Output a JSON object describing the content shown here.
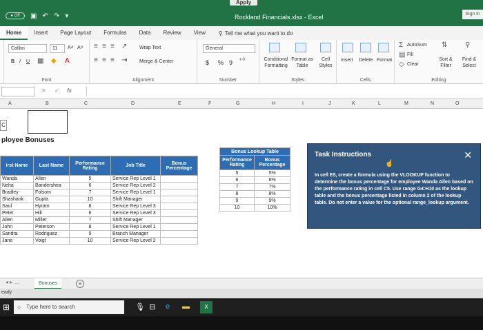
{
  "window": {
    "apply_label": "Apply",
    "title": "Rockland Financials.xlsx - Excel",
    "autosave_label": "● Off",
    "sign_in": "Sign in"
  },
  "tabs": [
    "Home",
    "Insert",
    "Page Layout",
    "Formulas",
    "Data",
    "Review",
    "View"
  ],
  "tell_me": "Tell me what you want to do",
  "ribbon": {
    "font_name": "Calibri",
    "font_size": "11",
    "grow_font": "A˄",
    "shrink_font": "A˅",
    "bold": "B",
    "italic": "I",
    "underline": "U",
    "wrap_text": "Wrap Text",
    "merge_center": "Merge & Center",
    "number_format": "General",
    "currency": "$",
    "percent": "%",
    "comma": "9",
    "cond_formatting": "Conditional Formatting",
    "format_as_table": "Format as Table",
    "cell_styles": "Cell Styles",
    "insert": "Insert",
    "delete": "Delete",
    "format": "Format",
    "autosum": "AutoSum",
    "fill": "Fill",
    "clear": "Clear",
    "sort_filter": "Sort & Filter",
    "find_select": "Find & Select",
    "groups": [
      "Font",
      "Alignment",
      "Number",
      "Styles",
      "Cells",
      "Editing"
    ]
  },
  "formula_bar": {
    "cancel": "✕",
    "enter": "✓",
    "fx": "fx"
  },
  "columns": [
    "A",
    "B",
    "C",
    "D",
    "E",
    "F",
    "G",
    "H",
    "I",
    "J",
    "K",
    "L",
    "M",
    "N",
    "O"
  ],
  "sheet": {
    "cell_label": "C",
    "title": "ployee Bonuses",
    "headers": [
      "irst Name",
      "Last Name",
      "Performance Rating",
      "Job Title",
      "Bonus Percentage"
    ],
    "rows": [
      [
        "Wanda",
        "Allen",
        "5",
        "Service Rep Level 1"
      ],
      [
        "Neha",
        "Bandershea",
        "6",
        "Service Rep Level 2"
      ],
      [
        "Bradley",
        "Folsom",
        "7",
        "Service Rep Level 1"
      ],
      [
        "Shashank",
        "Gupta",
        "10",
        "Shift Manager"
      ],
      [
        "Saul",
        "Hyram",
        "8",
        "Service Rep Level 3"
      ],
      [
        "Peter",
        "Hill",
        "6",
        "Service Rep Level 3"
      ],
      [
        "Allen",
        "Miller",
        "7",
        "Shift Manager"
      ],
      [
        "John",
        "Peterson",
        "8",
        "Service Rep Level 1"
      ],
      [
        "Sandra",
        "Rodriguez",
        "9",
        "Branch Manager"
      ],
      [
        "Jane",
        "Voigt",
        "10",
        "Service Rep Level 2"
      ]
    ],
    "lookup": {
      "title": "Bonus Lookup Table",
      "headers": [
        "Performance Rating",
        "Bonus Percentage"
      ],
      "rows": [
        [
          "5",
          "5%"
        ],
        [
          "6",
          "6%"
        ],
        [
          "7",
          "7%"
        ],
        [
          "8",
          "8%"
        ],
        [
          "9",
          "9%"
        ],
        [
          "10",
          "10%"
        ]
      ]
    }
  },
  "task": {
    "heading": "Task Instructions",
    "close": "✕",
    "body": "In cell E5, create a formula using the VLOOKUP function to determine the bonus percentage for employee Wanda Allen based on the performance rating in cell C5. Use range G4:H10 as the lookup table and the bonus percentage listed in column 2 of the lookup table. Do not enter a value for the optional range_lookup argument."
  },
  "sheet_tab": "Bonuses",
  "status": "eady",
  "taskbar": {
    "search_placeholder": "Type here to search"
  }
}
